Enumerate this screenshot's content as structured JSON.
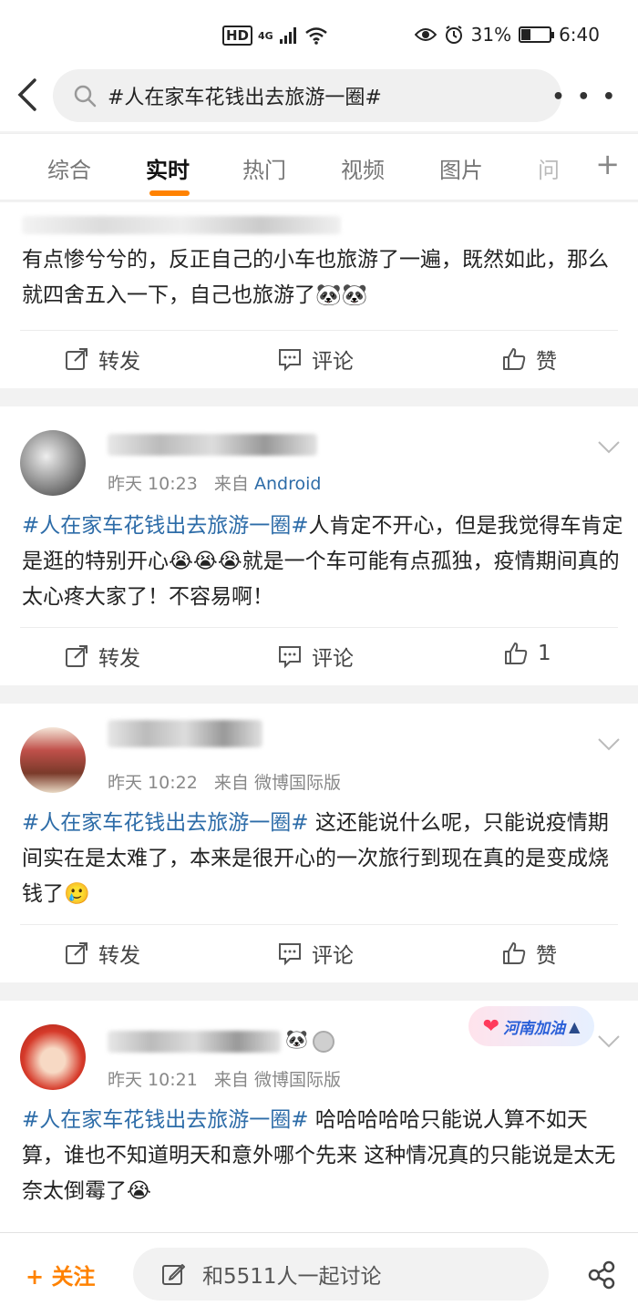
{
  "status": {
    "network": "HD",
    "signal": "4G",
    "battery": "31%",
    "time": "6:40"
  },
  "search": {
    "query": "#人在家车花钱出去旅游一圈#"
  },
  "tabs": [
    "综合",
    "实时",
    "热门",
    "视频",
    "图片",
    "问"
  ],
  "posts": [
    {
      "text": "有点惨兮兮的，反正自己的小车也旅游了一遍，既然如此，那么就四舍五入一下，自己也旅游了",
      "actions": {
        "repost": "转发",
        "comment": "评论",
        "like": "赞"
      }
    },
    {
      "time": "昨天 10:23",
      "from": "来自",
      "source": "Android",
      "tag": "#人在家车花钱出去旅游一圈#",
      "text_a": "人肯定不开心，但是我觉得车肯定是逛的特别开心",
      "text_b": "就是一个车可能有点孤独，疫情期间真的太心疼大家了！不容易啊！",
      "actions": {
        "repost": "转发",
        "comment": "评论",
        "like": "1"
      }
    },
    {
      "time": "昨天 10:22",
      "from": "来自",
      "source": "微博国际版",
      "tag": "#人在家车花钱出去旅游一圈#",
      "text": " 这还能说什么呢，只能说疫情期间实在是太难了，本来是很开心的一次旅行到现在真的是变成烧钱了",
      "actions": {
        "repost": "转发",
        "comment": "评论",
        "like": "赞"
      }
    },
    {
      "time": "昨天 10:21",
      "from": "来自",
      "source": "微博国际版",
      "badge": "河南加油",
      "tag": "#人在家车花钱出去旅游一圈#",
      "text": "  哈哈哈哈哈只能说人算不如天算，谁也不知道明天和意外哪个先来 这种情况真的只能说是太无奈太倒霉了"
    }
  ],
  "bottom": {
    "follow": "+ 关注",
    "discuss": "和5511人一起讨论"
  }
}
